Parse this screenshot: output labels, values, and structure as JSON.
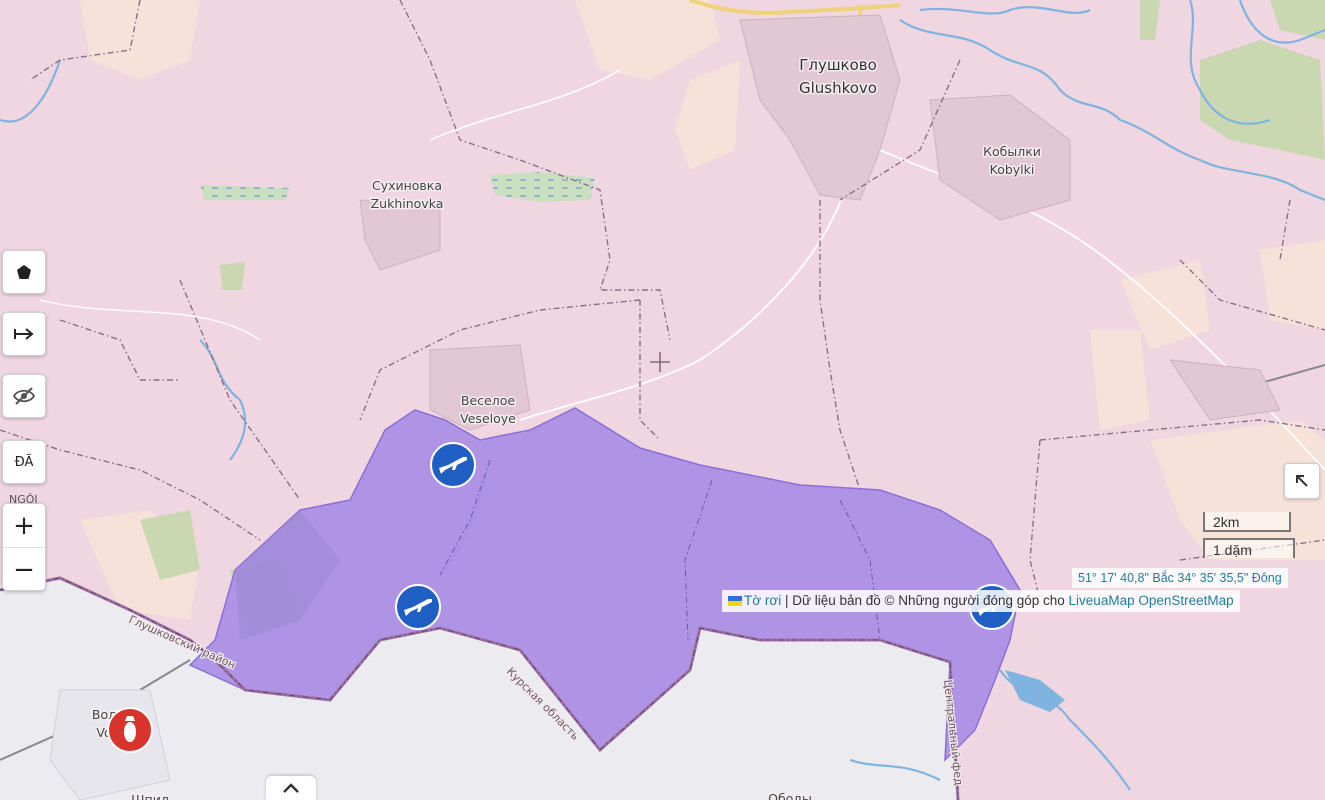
{
  "map": {
    "places": [
      {
        "id": "glushkovo",
        "ru": "Глушково",
        "en": "Glushkovo"
      },
      {
        "id": "sukhinovka",
        "ru": "Сухиновка",
        "en": "Zukhinovka"
      },
      {
        "id": "veseloye",
        "ru": "Веселое",
        "en": "Veseloye"
      },
      {
        "id": "kobylki",
        "ru": "Кобылки",
        "en": "Kobylki"
      },
      {
        "id": "volfino",
        "ru": "Вол",
        "en": "Vo"
      },
      {
        "id": "shpil",
        "ru": "Шпил",
        "en": ""
      },
      {
        "id": "obody",
        "ru": "",
        "en": "Ободы"
      }
    ],
    "region_labels": [
      {
        "id": "glushkovsky-rayon",
        "text": "Глушковский район"
      },
      {
        "id": "kursk-oblast",
        "text": "Курская область"
      },
      {
        "id": "central-fed",
        "text": "Центральный фед"
      }
    ],
    "markers": [
      {
        "id": "unit-1",
        "icon": "rifle-icon",
        "color": "#1f5fc4"
      },
      {
        "id": "unit-2",
        "icon": "rifle-icon",
        "color": "#1f5fc4"
      },
      {
        "id": "unit-3",
        "icon": "rifle-icon",
        "color": "#1f5fc4"
      },
      {
        "id": "bomb",
        "icon": "bomb-icon",
        "color": "#d9342b"
      }
    ],
    "colors": {
      "russia_land": "#efd6e0",
      "occupied_area": "#a98ee6",
      "ukraine_land": "#ececf0",
      "water": "#7fb3e0",
      "border": "#8a6f86"
    }
  },
  "controls": {
    "polygon_tool_icon": "pentagon-icon",
    "measure_icon": "arrow-right-bar-icon",
    "hide_icon": "eye-slash-icon",
    "lang_label": "ĐÃ",
    "lang_sub": "NGÔI",
    "zoom_in": "+",
    "zoom_out": "−"
  },
  "scale": {
    "km": "2km",
    "mile": "1 dặm"
  },
  "coords": "51° 17' 40,8\" Bắc 34° 35' 35,5\" Đông",
  "attribution": {
    "flyer": "Tờ rơi",
    "text": " | Dữ liệu bản đồ © Những người đóng góp cho ",
    "link1": "LiveuaMap",
    "link2": "OpenStreetMap"
  }
}
